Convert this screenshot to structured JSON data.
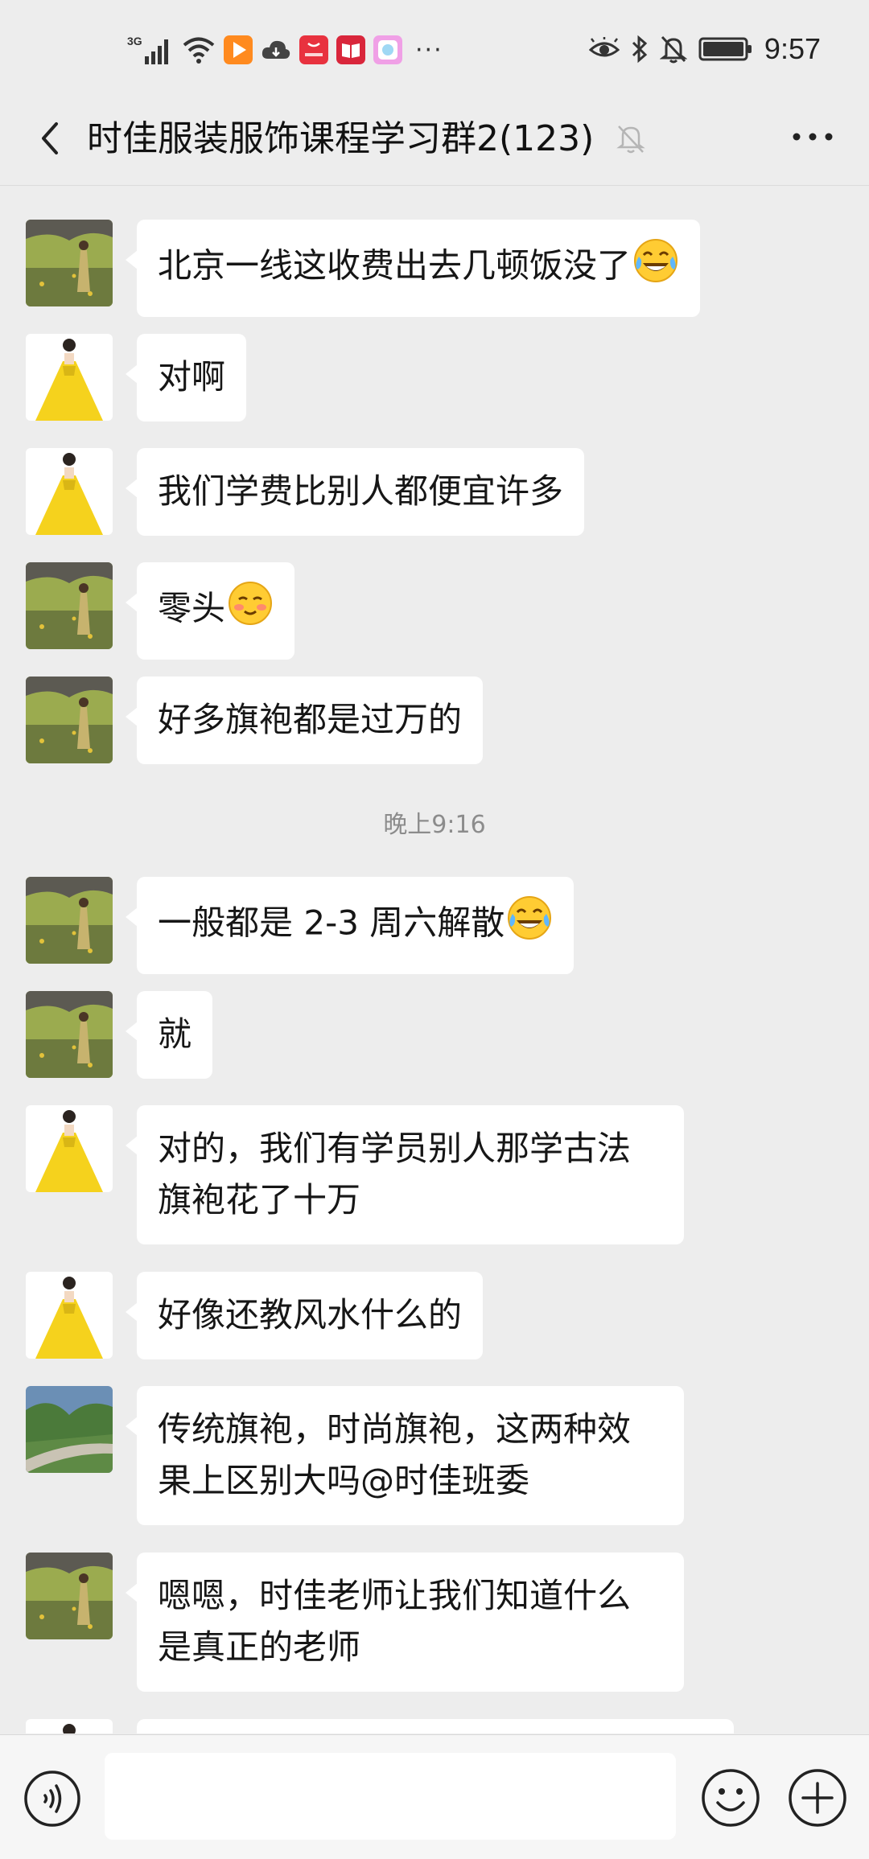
{
  "status_bar": {
    "signal": "3G",
    "time": "9:57",
    "icons": [
      "signal-icon",
      "wifi-icon",
      "video-app-icon",
      "cloud-icon",
      "huawei-store-icon",
      "reader-app-icon",
      "gallery-app-icon",
      "more-dots-icon",
      "eye-icon",
      "bluetooth-icon",
      "notifications-off-icon",
      "battery-icon"
    ]
  },
  "header": {
    "title": "时佳服装服饰课程学习群2(123)",
    "muted": true
  },
  "avatars": {
    "grass": {
      "colors": [
        "#6d7a3e",
        "#9bab4f",
        "#c7b36e"
      ]
    },
    "yellow_dress": {
      "colors": [
        "#f5d21d",
        "#ffffff"
      ]
    },
    "road": {
      "colors": [
        "#6b8fb5",
        "#4b7a3a",
        "#c9c3b4"
      ]
    }
  },
  "messages": [
    {
      "avatar": "grass",
      "text": "北京一线这收费出去几顿饭没了",
      "emoji": "laugh-cry"
    },
    {
      "avatar": "yellow_dress",
      "text": "对啊"
    },
    {
      "avatar": "yellow_dress",
      "text": "我们学费比别人都便宜许多"
    },
    {
      "avatar": "grass",
      "text": "零头",
      "emoji": "blush"
    },
    {
      "avatar": "grass",
      "text": "好多旗袍都是过万的"
    },
    {
      "avatar": "grass",
      "text": "一般都是 2-3 周六解散",
      "emoji": "laugh-cry"
    },
    {
      "avatar": "grass",
      "text": "就"
    },
    {
      "avatar": "yellow_dress",
      "text": "对的，我们有学员别人那学古法旗袍花了十万"
    },
    {
      "avatar": "yellow_dress",
      "text": "好像还教风水什么的"
    },
    {
      "avatar": "road",
      "text": "传统旗袍，时尚旗袍，这两种效果上区别大吗@时佳班委"
    },
    {
      "avatar": "grass",
      "text": "嗯嗯，时佳老师让我们知道什么是真正的老师"
    }
  ],
  "timestamp": "晚上9:16",
  "input_bar": {
    "voice_icon": "voice-input-icon",
    "emoji_icon": "emoji-icon",
    "plus_icon": "plus-icon"
  }
}
